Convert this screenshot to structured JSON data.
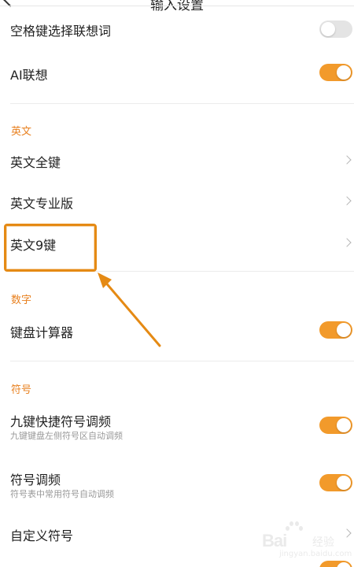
{
  "header": {
    "title": "输入设置"
  },
  "rows": {
    "space_select": {
      "label": "空格键选择联想词",
      "enabled": false
    },
    "ai_assoc": {
      "label": "AI联想",
      "enabled": true
    },
    "english_full": {
      "label": "英文全键"
    },
    "english_pro": {
      "label": "英文专业版"
    },
    "english_9": {
      "label": "英文9键"
    },
    "calculator": {
      "label": "键盘计算器",
      "enabled": true
    },
    "nine_key_freq": {
      "label": "九键快捷符号调频",
      "sub": "九键键盘左侧符号区自动调频",
      "enabled": true
    },
    "symbol_freq": {
      "label": "符号调频",
      "sub": "符号表中常用符号自动调频",
      "enabled": true
    },
    "custom_symbols": {
      "label": "自定义符号"
    }
  },
  "sections": {
    "english": "英文",
    "numbers": "数字",
    "symbols": "符号"
  },
  "watermark": {
    "logo": "Bai",
    "text": "经验",
    "url": "jingyan.baidu.com"
  },
  "colors": {
    "accent": "#f29a2b",
    "section": "#e8801f",
    "annotation": "#e58a14"
  }
}
